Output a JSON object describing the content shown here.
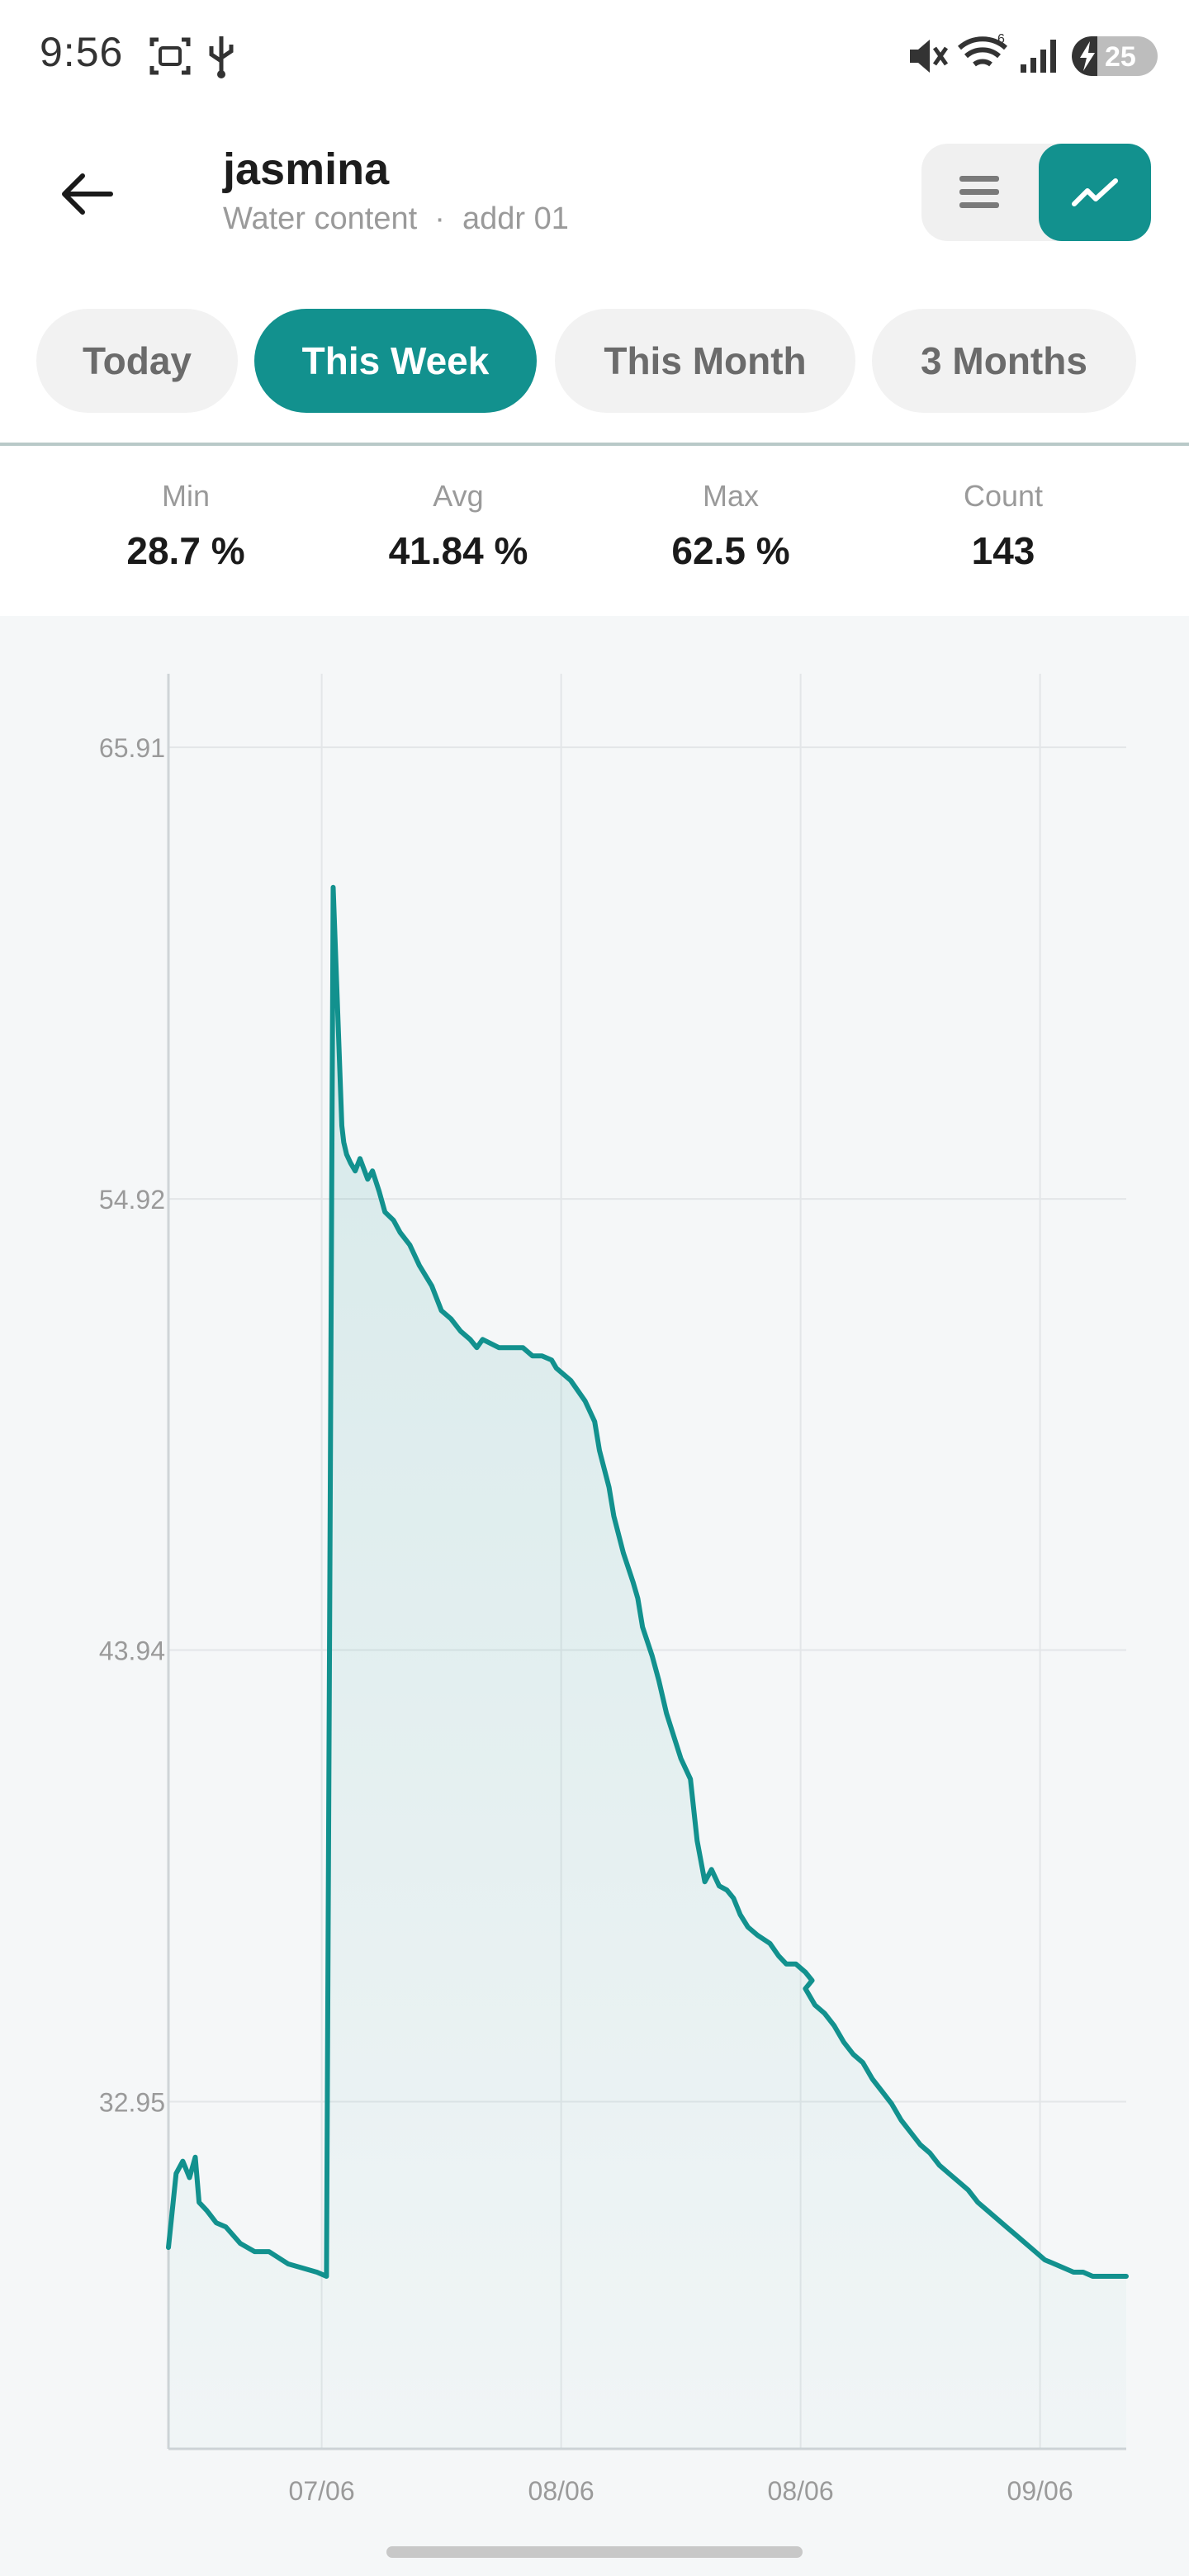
{
  "status_bar": {
    "time": "9:56",
    "battery": "25"
  },
  "header": {
    "title": "jasmina",
    "subtitle": "Water content  ·  addr 01"
  },
  "tabs": [
    {
      "label": "Today",
      "active": false
    },
    {
      "label": "This Week",
      "active": true
    },
    {
      "label": "This Month",
      "active": false
    },
    {
      "label": "3 Months",
      "active": false
    }
  ],
  "stats": [
    {
      "label": "Min",
      "value": "28.7 %"
    },
    {
      "label": "Avg",
      "value": "41.84 %"
    },
    {
      "label": "Max",
      "value": "62.5 %"
    },
    {
      "label": "Count",
      "value": "143"
    }
  ],
  "colors": {
    "accent": "#12918e"
  },
  "chart_data": {
    "type": "area",
    "y_ticks": [
      "65.91",
      "54.92",
      "43.94",
      "32.95"
    ],
    "y_tick_values": [
      65.91,
      54.92,
      43.94,
      32.95
    ],
    "x_ticks": [
      "07/06",
      "08/06",
      "08/06",
      "09/06"
    ],
    "x_tick_values": [
      0.16,
      0.41,
      0.66,
      0.91
    ],
    "ylim": [
      24.5,
      67.5
    ],
    "xlim": [
      0,
      1
    ],
    "grid": true,
    "series": [
      {
        "x": [
          0.0,
          0.008,
          0.015,
          0.022,
          0.028,
          0.032,
          0.04,
          0.05,
          0.06,
          0.075,
          0.09,
          0.105,
          0.125,
          0.14,
          0.155,
          0.165,
          0.172,
          0.181,
          0.183,
          0.186,
          0.19,
          0.195,
          0.2,
          0.208,
          0.213,
          0.22,
          0.226,
          0.235,
          0.242,
          0.252,
          0.262,
          0.275,
          0.285,
          0.295,
          0.305,
          0.315,
          0.322,
          0.328,
          0.345,
          0.36,
          0.37,
          0.38,
          0.39,
          0.4,
          0.405,
          0.42,
          0.435,
          0.445,
          0.45,
          0.46,
          0.465,
          0.475,
          0.485,
          0.49,
          0.495,
          0.505,
          0.512,
          0.52,
          0.535,
          0.545,
          0.552,
          0.56,
          0.567,
          0.575,
          0.583,
          0.59,
          0.597,
          0.605,
          0.615,
          0.628,
          0.637,
          0.645,
          0.655,
          0.665,
          0.672,
          0.665,
          0.675,
          0.685,
          0.695,
          0.705,
          0.715,
          0.725,
          0.735,
          0.745,
          0.755,
          0.765,
          0.775,
          0.785,
          0.795,
          0.805,
          0.815,
          0.825,
          0.835,
          0.845,
          0.855,
          0.865,
          0.875,
          0.885,
          0.895,
          0.905,
          0.915,
          0.925,
          0.935,
          0.945,
          0.955,
          0.965,
          0.975,
          0.985,
          0.995,
          1.0
        ],
        "y": [
          29.4,
          31.2,
          31.5,
          31.1,
          31.6,
          30.5,
          30.3,
          30.0,
          29.9,
          29.5,
          29.3,
          29.3,
          29.0,
          28.9,
          28.8,
          28.7,
          62.5,
          56.7,
          56.3,
          56.0,
          55.8,
          55.6,
          55.9,
          55.4,
          55.6,
          55.1,
          54.6,
          54.4,
          54.1,
          53.8,
          53.3,
          52.8,
          52.2,
          52.0,
          51.7,
          51.5,
          51.3,
          51.5,
          51.3,
          51.3,
          51.3,
          51.1,
          51.1,
          51.0,
          50.8,
          50.5,
          50.0,
          49.5,
          48.8,
          47.9,
          47.2,
          46.3,
          45.6,
          45.2,
          44.5,
          43.8,
          43.2,
          42.4,
          41.3,
          40.8,
          39.3,
          38.3,
          38.6,
          38.2,
          38.1,
          37.9,
          37.5,
          37.2,
          37.0,
          36.8,
          36.5,
          36.3,
          36.3,
          36.1,
          35.9,
          35.7,
          35.3,
          35.1,
          34.8,
          34.4,
          34.1,
          33.9,
          33.5,
          33.2,
          32.9,
          32.5,
          32.2,
          31.9,
          31.7,
          31.4,
          31.2,
          31.0,
          30.8,
          30.5,
          30.3,
          30.1,
          29.9,
          29.7,
          29.5,
          29.3,
          29.1,
          29.0,
          28.9,
          28.8,
          28.8,
          28.7,
          28.7,
          28.7,
          28.7,
          28.7
        ]
      }
    ]
  }
}
